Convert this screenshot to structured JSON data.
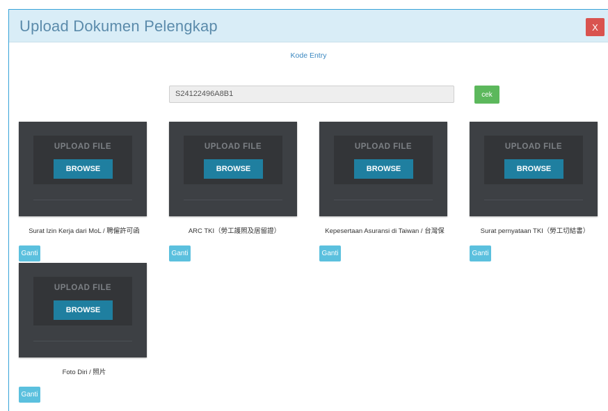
{
  "modal": {
    "title": "Upload Dokumen Pelengkap",
    "close_label": "X"
  },
  "kode_entry": {
    "label": "Kode Entry",
    "value": "S24122496A8B1",
    "check_label": "cek"
  },
  "upload": {
    "upload_text": "UPLOAD FILE",
    "browse_label": "BROWSE",
    "replace_label": "Ganti"
  },
  "documents": [
    {
      "caption": "Surat Izin Kerja dari MoL / 聘僱許可函"
    },
    {
      "caption": "ARC TKI（勞工護照及居留證）"
    },
    {
      "caption": "Kepesertaan Asuransi di Taiwan / 台灣保"
    },
    {
      "caption": "Surat pernyataan TKI（勞工切結書）"
    },
    {
      "caption": "Foto Diri / 照片"
    }
  ],
  "colors": {
    "header_bg": "#d9edf7",
    "close": "#d9534f",
    "check": "#5cb85c",
    "browse": "#1f7fa0",
    "replace": "#5bc0de"
  }
}
